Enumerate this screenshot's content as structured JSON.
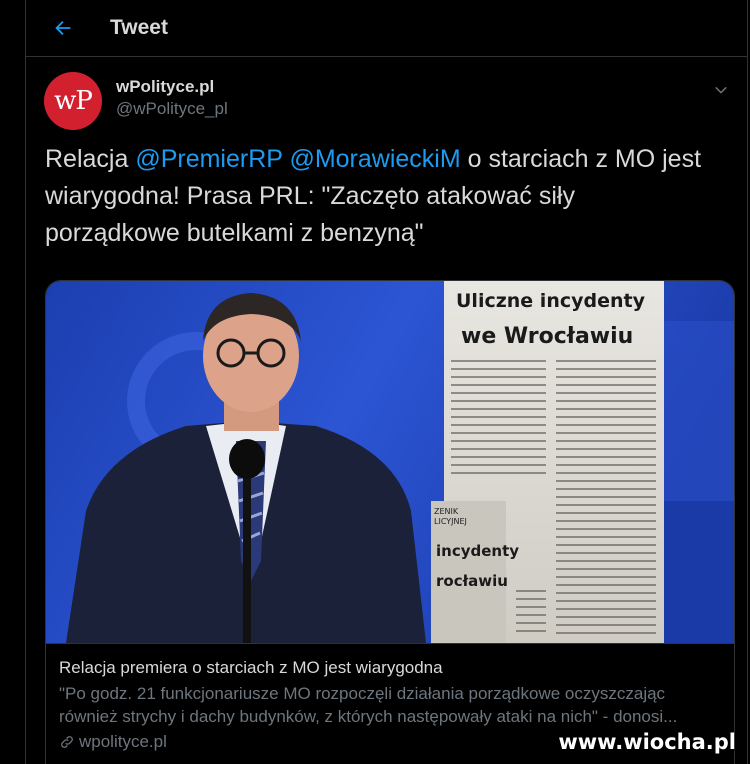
{
  "header": {
    "title": "Tweet",
    "back_icon": "arrow-left-icon",
    "accent": "#1d9bf0"
  },
  "author": {
    "display_name": "wPolityce.pl",
    "handle": "@wPolityce_pl",
    "avatar_text": "wP",
    "avatar_color": "#d3202f"
  },
  "tweet": {
    "text_1": "Relacja ",
    "mention_1": "@PremierRP",
    "text_2": " ",
    "mention_2": "@MorawieckiM",
    "text_3": " o starciach z MO jest wiarygodna! Prasa PRL: \"Zaczęto atakować siły porządkowe butelkami z benzyną\""
  },
  "card": {
    "newspaper_headline_1": "Uliczne incydenty",
    "newspaper_headline_2": "we Wrocławiu",
    "newspaper_small_1": "ZENIK",
    "newspaper_small_2": "LICYJNEJ",
    "newspaper_small_3": "incydenty",
    "newspaper_small_4": "rocławiu",
    "title": "Relacja premiera o starciach z MO jest wiarygodna",
    "description": "\"Po godz. 21 funkcjonariusze MO rozpoczęli działania porządkowe oczyszczając również strychy i dachy budynków, z których następowały ataki na nich\" - donosi...",
    "domain": "wpolityce.pl"
  },
  "watermark": "www.wiocha.pl"
}
